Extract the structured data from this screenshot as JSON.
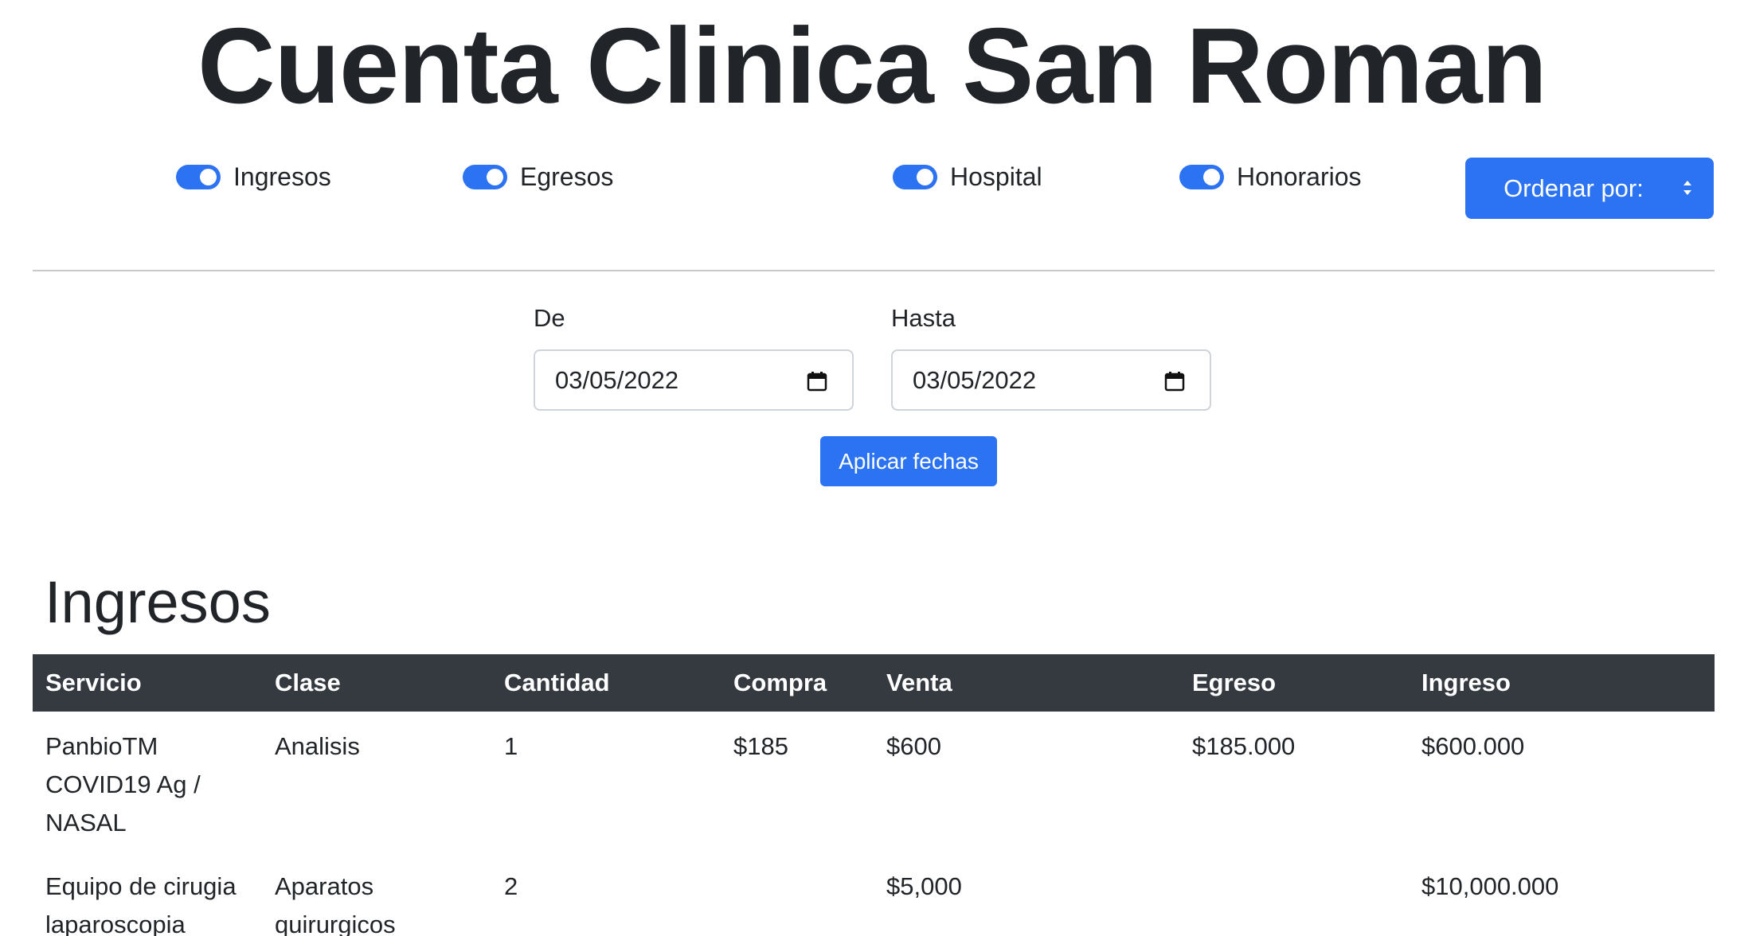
{
  "title": "Cuenta Clinica San Roman",
  "filters": {
    "ingresos_label": "Ingresos",
    "egresos_label": "Egresos",
    "hospital_label": "Hospital",
    "honorarios_label": "Honorarios"
  },
  "order_select": {
    "label": "Ordenar por:"
  },
  "dates": {
    "from_label": "De",
    "from_value": "03/05/2022",
    "to_label": "Hasta",
    "to_value": "03/05/2022",
    "apply_label": "Aplicar fechas"
  },
  "section": {
    "title": "Ingresos"
  },
  "table": {
    "headers": [
      "Servicio",
      "Clase",
      "Cantidad",
      "Compra",
      "Venta",
      "Egreso",
      "Ingreso"
    ],
    "rows": [
      {
        "servicio": "PanbioTM COVID19 Ag / NASAL",
        "clase": "Analisis",
        "cantidad": "1",
        "compra": "$185",
        "venta": "$600",
        "egreso": "$185.000",
        "ingreso": "$600.000"
      },
      {
        "servicio": "Equipo de cirugia laparoscopia",
        "clase": "Aparatos quirurgicos",
        "cantidad": "2",
        "compra": "",
        "venta": "$5,000",
        "egreso": "",
        "ingreso": "$10,000.000"
      }
    ]
  },
  "colors": {
    "primary": "#2b73f3",
    "table_header": "#343a40",
    "text": "#212529"
  }
}
